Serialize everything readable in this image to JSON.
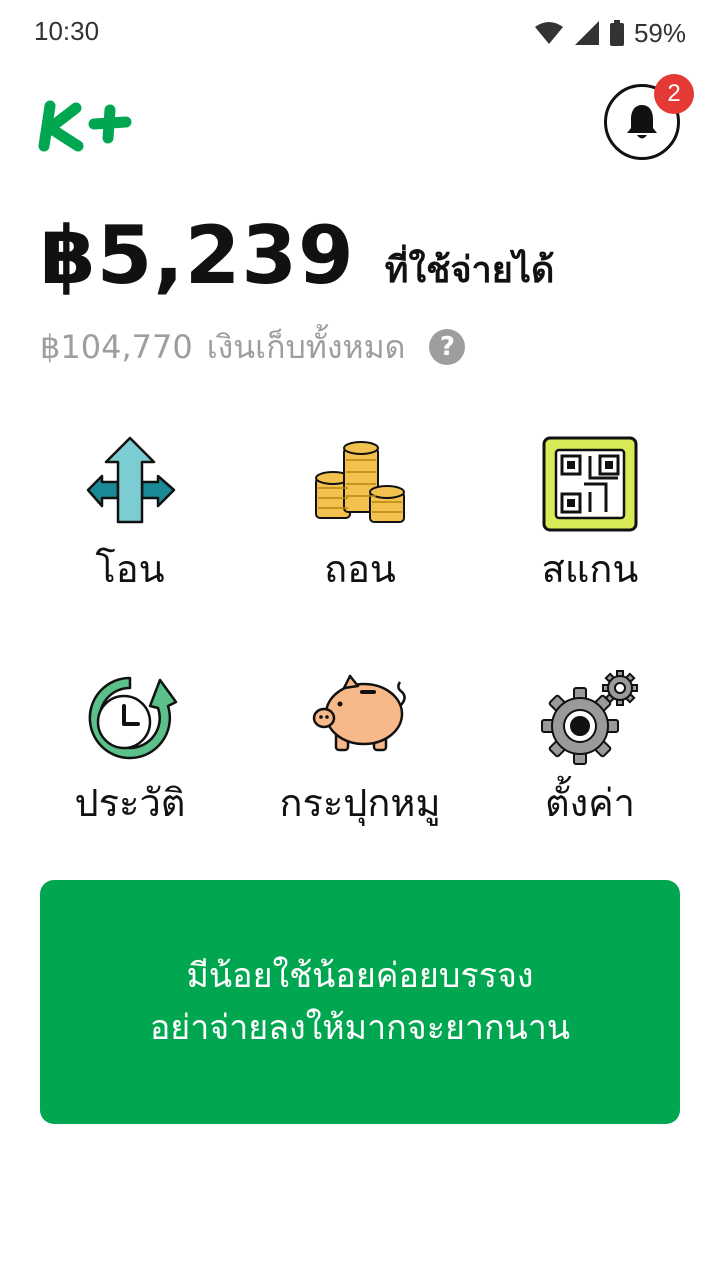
{
  "status_bar": {
    "time": "10:30",
    "battery": "59%",
    "icons": [
      "wifi-icon",
      "signal-icon",
      "battery-icon"
    ]
  },
  "header": {
    "logo_text": "K+",
    "notification_count": "2",
    "brand_color": "#00a650",
    "badge_color": "#e53935"
  },
  "balance": {
    "amount": "฿5,239",
    "label": "ที่ใช้จ่ายได้"
  },
  "savings": {
    "amount": "฿104,770",
    "label": "เงินเก็บทั้งหมด",
    "help_icon": "?"
  },
  "menu": [
    {
      "label": "โอน",
      "icon": "transfer-arrows-icon"
    },
    {
      "label": "ถอน",
      "icon": "coin-stack-icon"
    },
    {
      "label": "สแกน",
      "icon": "qr-code-icon"
    },
    {
      "label": "ประวัติ",
      "icon": "history-clock-icon"
    },
    {
      "label": "กระปุกหมู",
      "icon": "piggy-bank-icon"
    },
    {
      "label": "ตั้งค่า",
      "icon": "settings-gears-icon"
    }
  ],
  "quote": {
    "line1": "มีน้อยใช้น้อยค่อยบรรจง",
    "line2": "อย่าจ่ายลงให้มากจะยากนาน"
  }
}
